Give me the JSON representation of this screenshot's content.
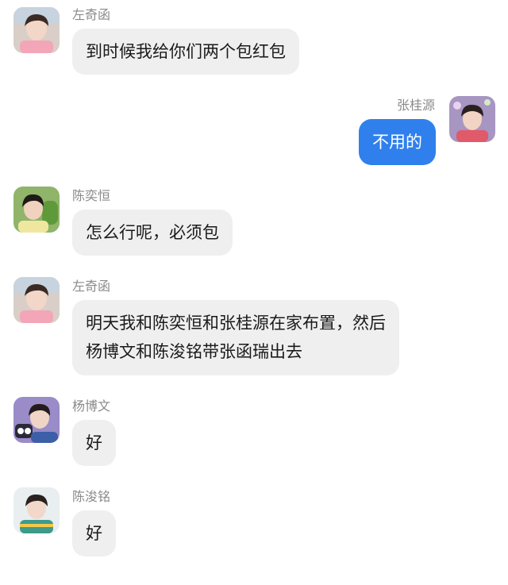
{
  "messages": [
    {
      "sender": "左奇函",
      "lines": [
        "到时候我给你们两个包红包"
      ],
      "mine": false
    },
    {
      "sender": "张桂源",
      "lines": [
        "不用的"
      ],
      "mine": true
    },
    {
      "sender": "陈奕恒",
      "lines": [
        "怎么行呢，必须包"
      ],
      "mine": false
    },
    {
      "sender": "左奇函",
      "lines": [
        "明天我和陈奕恒和张桂源在家布置，然后",
        "杨博文和陈浚铭带张函瑞出去"
      ],
      "mine": false
    },
    {
      "sender": "杨博文",
      "lines": [
        "好"
      ],
      "mine": false
    },
    {
      "sender": "陈浚铭",
      "lines": [
        "好"
      ],
      "mine": false
    }
  ],
  "colors": {
    "bubble_other": "#efefef",
    "bubble_mine": "#2f80ed",
    "name_text": "#8a8a8a"
  }
}
